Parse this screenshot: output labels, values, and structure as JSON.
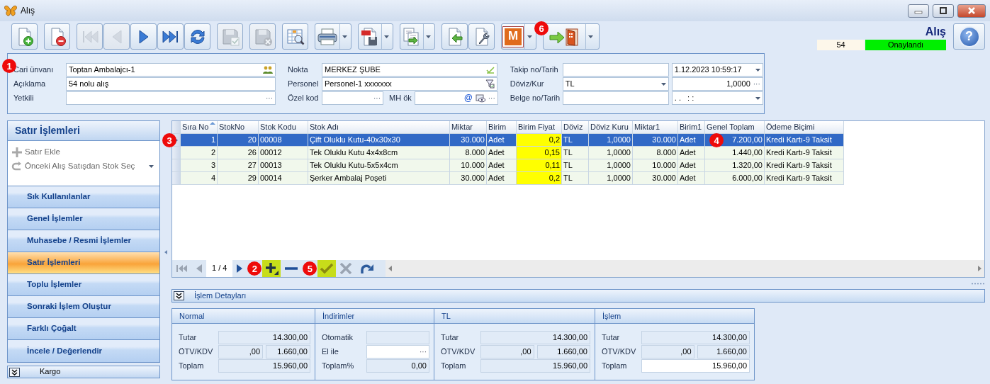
{
  "window": {
    "title": "Alış"
  },
  "toolbar": [
    [
      {
        "kind": "new",
        "disabled": false,
        "dropdown": false
      }
    ],
    [
      {
        "kind": "delete",
        "disabled": false,
        "dropdown": false
      }
    ],
    [
      {
        "kind": "first",
        "disabled": true,
        "dropdown": false
      },
      {
        "kind": "prev",
        "disabled": true,
        "dropdown": false
      },
      {
        "kind": "next",
        "disabled": false,
        "dropdown": false
      },
      {
        "kind": "last",
        "disabled": false,
        "dropdown": false
      },
      {
        "kind": "refresh",
        "disabled": false,
        "dropdown": false
      }
    ],
    [
      {
        "kind": "save",
        "disabled": true,
        "dropdown": false
      }
    ],
    [
      {
        "kind": "save-close",
        "disabled": true,
        "dropdown": false
      }
    ],
    [
      {
        "kind": "preview",
        "disabled": false,
        "dropdown": false
      }
    ],
    [
      {
        "kind": "print",
        "disabled": false,
        "dropdown": true
      }
    ],
    [
      {
        "kind": "pdf",
        "disabled": false,
        "dropdown": true
      }
    ],
    [
      {
        "kind": "export",
        "disabled": false,
        "dropdown": true
      }
    ],
    [
      {
        "kind": "import",
        "disabled": false,
        "dropdown": false
      },
      {
        "kind": "tools",
        "disabled": false,
        "dropdown": false
      }
    ],
    [
      {
        "kind": "letter",
        "text": "M",
        "disabled": false,
        "dropdown": true
      }
    ],
    [
      {
        "kind": "exit",
        "disabled": false,
        "dropdown": true,
        "callout": "6"
      }
    ]
  ],
  "form_title": "Alış",
  "record_no": "54",
  "status": "Onaylandı",
  "help": "?",
  "header": {
    "columns": [
      {
        "rows": [
          {
            "label": "Cari ünvanı",
            "callout": "1",
            "fields": [
              {
                "kind": "text",
                "value": "Toptan Ambalajcı-1",
                "addons": [
                  {
                    "kind": "people"
                  }
                ]
              }
            ]
          },
          {
            "label": "Açıklama",
            "fields": [
              {
                "kind": "text",
                "value": "54 nolu alış"
              }
            ]
          },
          {
            "label": "Yetkili",
            "fields": [
              {
                "kind": "text",
                "addons": [
                  {
                    "kind": "button",
                    "text": "···"
                  }
                ]
              }
            ]
          }
        ]
      },
      {
        "rows": [
          {
            "label": "Nokta",
            "fields": [
              {
                "kind": "text",
                "value": "MERKEZ ŞUBE",
                "addons": [
                  {
                    "kind": "check"
                  }
                ]
              }
            ]
          },
          {
            "label": "Personel",
            "fields": [
              {
                "kind": "text",
                "value": "Personel-1 xxxxxxx",
                "addons": [
                  {
                    "kind": "filter"
                  }
                ]
              }
            ]
          },
          {
            "label": "Özel kod",
            "fields": [
              {
                "kind": "text",
                "addons": [
                  {
                    "kind": "button",
                    "text": "···"
                  }
                ]
              },
              {
                "kind": "text",
                "label": "MH ök",
                "addons": [
                  {
                    "kind": "link",
                    "text": "@"
                  },
                  {
                    "kind": "view"
                  },
                  {
                    "kind": "button",
                    "text": "···"
                  }
                ]
              }
            ]
          }
        ]
      },
      {
        "rows": [
          {
            "label": "Takip no/Tarih",
            "fields": [
              {
                "kind": "text"
              },
              {
                "kind": "combo",
                "value": "1.12.2023 10:59:17"
              }
            ]
          },
          {
            "label": "Döviz/Kur",
            "fields": [
              {
                "kind": "combo",
                "value": "TL"
              },
              {
                "kind": "number",
                "value": "1,0000",
                "addons": [
                  {
                    "kind": "button",
                    "text": "···"
                  }
                ]
              }
            ]
          },
          {
            "label": "Belge no/Tarih",
            "fields": [
              {
                "kind": "text"
              },
              {
                "kind": "combo",
                "value": ". .   : :"
              }
            ]
          }
        ]
      }
    ]
  },
  "sidebar": {
    "title": "Satır İşlemleri",
    "actions": [
      {
        "kind": "add",
        "label": "Satır Ekle",
        "disabled": true,
        "dropdown": false
      },
      {
        "kind": "pick",
        "label": "Önceki Alış Satışdan Stok Seç",
        "disabled": true,
        "dropdown": true
      }
    ],
    "groups": [
      {
        "label": "Sık Kullanılanlar",
        "selected": false
      },
      {
        "label": "Genel İşlemler",
        "selected": false
      },
      {
        "label": "Muhasebe / Resmi İşlemler",
        "selected": false
      },
      {
        "label": "Satır İşlemleri",
        "selected": true
      },
      {
        "label": "Toplu İşlemler",
        "selected": false
      },
      {
        "label": "Sonraki İşlem Oluştur",
        "selected": false
      },
      {
        "label": "Farklı Çoğalt",
        "selected": false
      },
      {
        "label": "İncele / Değerlendir",
        "selected": false
      }
    ],
    "footer": "Kargo"
  },
  "grid": {
    "columns": [
      {
        "label": "Sıra No",
        "sorted": true,
        "highlight": false
      },
      {
        "label": "StokNo",
        "sorted": false,
        "highlight": false
      },
      {
        "label": "Stok Kodu",
        "sorted": false,
        "highlight": false
      },
      {
        "label": "Stok Adı",
        "sorted": false,
        "highlight": false
      },
      {
        "label": "Miktar",
        "sorted": false,
        "highlight": false
      },
      {
        "label": "Birim",
        "sorted": false,
        "highlight": false
      },
      {
        "label": "Birim Fiyat",
        "sorted": false,
        "highlight": true
      },
      {
        "label": "Döviz",
        "sorted": false,
        "highlight": false
      },
      {
        "label": "Döviz Kuru",
        "sorted": false,
        "highlight": false
      },
      {
        "label": "Miktar1",
        "sorted": false,
        "highlight": false
      },
      {
        "label": "Birim1",
        "sorted": false,
        "highlight": false
      },
      {
        "label": "Genel Toplam",
        "sorted": false,
        "highlight": false
      },
      {
        "label": "Ödeme Biçimi",
        "sorted": false,
        "highlight": false
      }
    ],
    "rows": [
      {
        "selected": true,
        "callout": "3",
        "cells": [
          "1",
          "20",
          "00008",
          "Çift Oluklu Kutu-40x30x30",
          "30.000",
          "Adet",
          "0,2",
          "TL",
          "1,0000",
          "30.000",
          "Adet",
          {
            "text": "7.200,00",
            "callout": "4"
          },
          "Kredi Kartı-9 Taksit"
        ]
      },
      {
        "selected": false,
        "cells": [
          "2",
          "26",
          "00012",
          "Tek Oluklu Kutu 4x4x8cm",
          "8.000",
          "Adet",
          "0,15",
          "TL",
          "1,0000",
          "8.000",
          "Adet",
          "1.440,00",
          "Kredi Kartı-9 Taksit"
        ]
      },
      {
        "selected": false,
        "cells": [
          "3",
          "27",
          "00013",
          "Tek Oluklu Kutu-5x5x4cm",
          "10.000",
          "Adet",
          "0,11",
          "TL",
          "1,0000",
          "10.000",
          "Adet",
          "1.320,00",
          "Kredi Kartı-9 Taksit"
        ]
      },
      {
        "selected": false,
        "cells": [
          "4",
          "29",
          "00014",
          "Şerker Ambalaj Poşeti",
          "30.000",
          "Adet",
          "0,2",
          "TL",
          "1,0000",
          "30.000",
          "Adet",
          "6.000,00",
          "Kredi Kartı-9 Taksit"
        ]
      }
    ],
    "navigator": [
      {
        "kind": "first",
        "disabled": true,
        "highlight": false
      },
      {
        "kind": "prev",
        "disabled": true,
        "highlight": false
      },
      {
        "kind": "page",
        "text": "1 / 4"
      },
      {
        "kind": "next",
        "disabled": false,
        "highlight": false
      },
      {
        "kind": "add",
        "disabled": false,
        "highlight": true,
        "callout": "2"
      },
      {
        "kind": "remove",
        "disabled": false,
        "highlight": false
      },
      {
        "kind": "apply",
        "disabled": false,
        "highlight": true,
        "callout": "5"
      },
      {
        "kind": "cancel",
        "disabled": true,
        "highlight": false
      },
      {
        "kind": "redo",
        "disabled": false,
        "highlight": false
      }
    ]
  },
  "details": {
    "title": "İşlem Detayları",
    "panels": [
      {
        "title": "Normal",
        "rows": [
          {
            "label": "Tutar",
            "values": [
              {
                "text": "14.300,00",
                "editable": false
              }
            ]
          },
          {
            "label": "ÖTV/KDV",
            "values": [
              {
                "text": ",00",
                "editable": false
              },
              {
                "text": "1.660,00",
                "editable": false
              }
            ]
          },
          {
            "label": "Toplam",
            "values": [
              {
                "text": "15.960,00",
                "editable": false
              }
            ]
          }
        ]
      },
      {
        "title": "İndirimler",
        "rows": [
          {
            "label": "Otomatik",
            "values": [
              {
                "editable": false
              }
            ]
          },
          {
            "label": "El ile",
            "values": [
              {
                "suffix": "···",
                "editable": true
              }
            ]
          },
          {
            "label": "Toplam%",
            "values": [
              {
                "text": "0,00",
                "editable": false
              }
            ]
          }
        ]
      },
      {
        "title": "TL",
        "rows": [
          {
            "label": "Tutar",
            "values": [
              {
                "text": "14.300,00",
                "editable": false
              }
            ]
          },
          {
            "label": "ÖTV/KDV",
            "values": [
              {
                "text": ",00",
                "editable": false
              },
              {
                "text": "1.660,00",
                "editable": false
              }
            ]
          },
          {
            "label": "Toplam",
            "values": [
              {
                "text": "15.960,00",
                "editable": false
              }
            ]
          }
        ]
      },
      {
        "title": "İşlem",
        "rows": [
          {
            "label": "Tutar",
            "values": [
              {
                "text": "14.300,00",
                "editable": false
              }
            ]
          },
          {
            "label": "ÖTV/KDV",
            "values": [
              {
                "text": ",00",
                "editable": false
              },
              {
                "text": "1.660,00",
                "editable": false
              }
            ]
          },
          {
            "label": "Toplam",
            "values": [
              {
                "text": "15.960,00",
                "editable": true
              }
            ]
          }
        ]
      }
    ]
  }
}
